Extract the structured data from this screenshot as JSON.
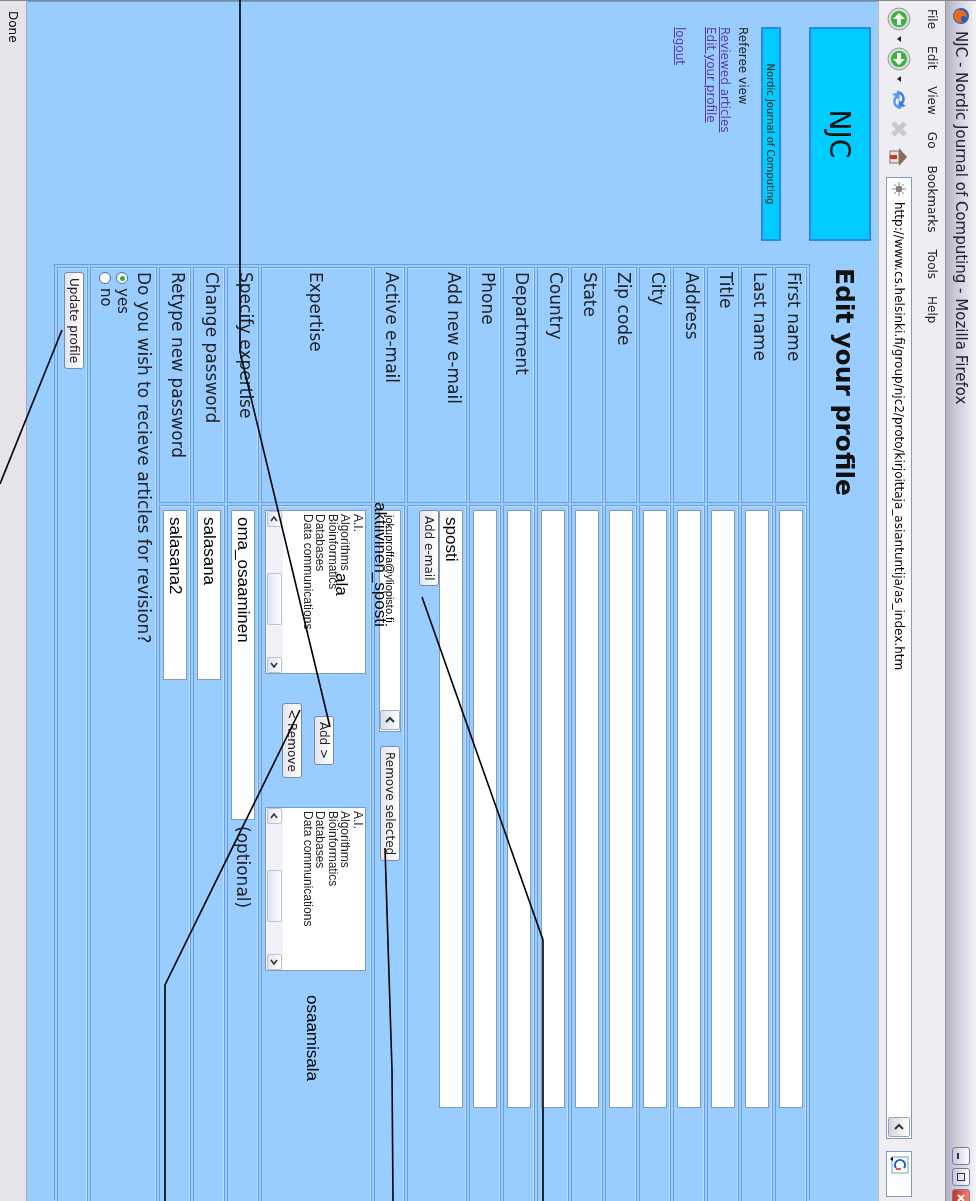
{
  "window": {
    "title": "NJC - Nordic Journal of Computing - Mozilla Firefox"
  },
  "menu": [
    "File",
    "Edit",
    "View",
    "Go",
    "Bookmarks",
    "Tools",
    "Help"
  ],
  "address_bar": {
    "url": "http://www.cs.helsinki.fi/group/njc2/proto/kirjoittaja_asiantuntija/as_index.htm"
  },
  "logo": "NJC",
  "heading": "Edit your profile",
  "sidebar": {
    "journal_button": "Nordic Journal of Computing",
    "section": "Referee view",
    "links": [
      "Reviewed articles",
      "Edit your profile",
      "logout"
    ]
  },
  "form": {
    "rows": [
      {
        "kind": "text",
        "label": "First name"
      },
      {
        "kind": "text",
        "label": "Last name"
      },
      {
        "kind": "text",
        "label": "Title"
      },
      {
        "kind": "text",
        "label": "Address"
      },
      {
        "kind": "text",
        "label": "City"
      },
      {
        "kind": "text",
        "label": "Zip code"
      },
      {
        "kind": "text",
        "label": "State"
      },
      {
        "kind": "text",
        "label": "Country"
      },
      {
        "kind": "text",
        "label": "Department"
      },
      {
        "kind": "text",
        "label": "Phone"
      },
      {
        "kind": "add_email",
        "label": "Add new e-mail",
        "value": "sposti",
        "button": "Add e-mail"
      },
      {
        "kind": "select",
        "label": "Active e-mail",
        "value": "jokuproffa@yliopisto.fi",
        "annotation": "aktiivinen_sposti",
        "button": "Remove selected"
      },
      {
        "kind": "expertise",
        "label": "Expertise",
        "available": [
          "A.I.",
          "Algorithms",
          "Bioinformatics",
          "Databases",
          "Data communications"
        ],
        "left_annotation": "ala",
        "add_button": "Add >",
        "remove_button": "< Remove",
        "chosen": [
          "A.I.",
          "Algorithms",
          "Bioinformatics",
          "Databases",
          "Data communications"
        ],
        "right_annotation": "osaamisala"
      },
      {
        "kind": "short",
        "label": "Specify expertise",
        "value": "oma_osaaminen",
        "note": "(optional)"
      },
      {
        "kind": "password",
        "label": "Change password",
        "value": "salasana"
      },
      {
        "kind": "password",
        "label": "Retype new password",
        "value": "salasana2"
      },
      {
        "kind": "radio",
        "question": "Do you wish to recieve articles for revision?",
        "options": [
          {
            "label": "yes",
            "selected": true
          },
          {
            "label": "no",
            "selected": false
          }
        ]
      },
      {
        "kind": "submit",
        "button": "Update profile"
      }
    ]
  },
  "status_bar": "Done"
}
